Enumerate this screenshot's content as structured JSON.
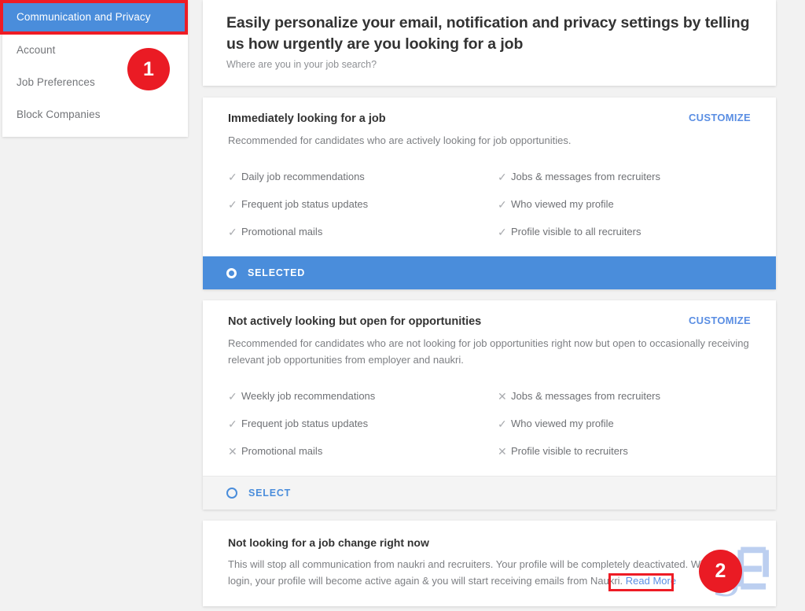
{
  "sidebar": {
    "header": {
      "label": "Communication and Privacy"
    },
    "items": [
      {
        "label": "Account"
      },
      {
        "label": "Job Preferences"
      },
      {
        "label": "Block Companies"
      }
    ]
  },
  "annotations": [
    {
      "number": "1",
      "target": "sidebar-header",
      "color": "#ea1b24"
    },
    {
      "number": "2",
      "target": "read-more-link",
      "color": "#ea1b24"
    }
  ],
  "intro": {
    "title": "Easily personalize your email, notification and privacy settings by telling us how urgently are you looking for a job",
    "subtitle": "Where are you in your job search?"
  },
  "options": [
    {
      "title": "Immediately looking for a job",
      "customize_label": "CUSTOMIZE",
      "description": "Recommended for candidates who are actively looking for job opportunities.",
      "features_left": [
        {
          "mark": "check",
          "label": "Daily job recommendations"
        },
        {
          "mark": "check",
          "label": "Frequent job status updates"
        },
        {
          "mark": "check",
          "label": "Promotional mails"
        }
      ],
      "features_right": [
        {
          "mark": "check",
          "label": "Jobs & messages from recruiters"
        },
        {
          "mark": "check",
          "label": "Who viewed my profile"
        },
        {
          "mark": "check",
          "label": "Profile visible to all recruiters"
        }
      ],
      "state_label": "SELECTED",
      "selected": true
    },
    {
      "title": "Not actively looking but open for opportunities",
      "customize_label": "CUSTOMIZE",
      "description": "Recommended for candidates who are not looking for job opportunities right now but open to occasionally receiving relevant job opportunities from employer and naukri.",
      "features_left": [
        {
          "mark": "check",
          "label": "Weekly job recommendations"
        },
        {
          "mark": "check",
          "label": "Frequent job status updates"
        },
        {
          "mark": "cross",
          "label": "Promotional mails"
        }
      ],
      "features_right": [
        {
          "mark": "cross",
          "label": "Jobs & messages from recruiters"
        },
        {
          "mark": "check",
          "label": "Who viewed my profile"
        },
        {
          "mark": "cross",
          "label": "Profile visible to recruiters"
        }
      ],
      "state_label": "SELECT",
      "selected": false
    }
  ],
  "deactivate": {
    "title": "Not looking for a job change right now",
    "description": "This will stop all communication from naukri and recruiters. Your profile will be completely deactivated. When you login, your profile will become active again & you will start receiving emails from Naukri.",
    "read_more_label": "Read More"
  },
  "marks": {
    "check": "✓",
    "cross": "✕"
  },
  "colors": {
    "accent_blue": "#4a8ddb",
    "link_blue": "#5a8ee3",
    "annotation_red": "#ea1b24",
    "page_background": "#f2f2f2",
    "card_background": "#ffffff",
    "watermark_blue": "#b9cdf0"
  }
}
